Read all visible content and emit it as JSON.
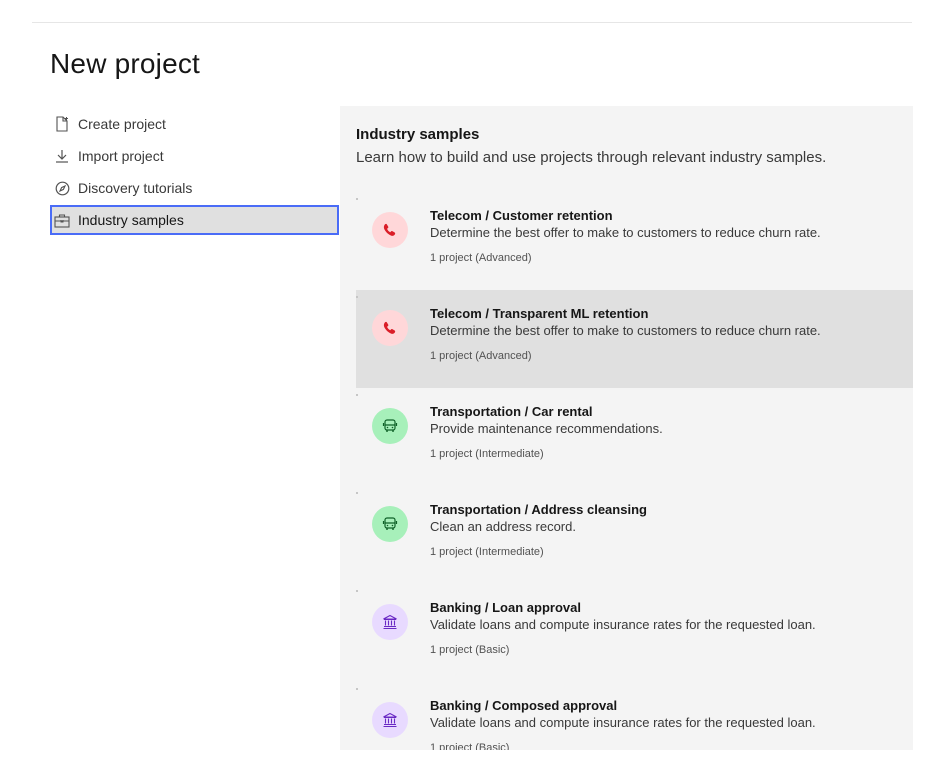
{
  "page": {
    "title": "New project"
  },
  "sidebar": {
    "items": [
      {
        "label": "Create project",
        "icon": "document-add-icon"
      },
      {
        "label": "Import project",
        "icon": "download-icon"
      },
      {
        "label": "Discovery tutorials",
        "icon": "compass-icon"
      },
      {
        "label": "Industry samples",
        "icon": "briefcase-icon",
        "selected": true
      }
    ]
  },
  "panel": {
    "title": "Industry samples",
    "description": "Learn how to build and use projects through relevant industry samples.",
    "cards": [
      {
        "title": "Telecom / Customer retention",
        "description": "Determine the best offer to make to customers to reduce churn rate.",
        "meta": "1 project (Advanced)",
        "icon": "phone-icon",
        "category": "telecom"
      },
      {
        "title": "Telecom / Transparent ML retention",
        "description": "Determine the best offer to make to customers to reduce churn rate.",
        "meta": "1 project (Advanced)",
        "icon": "phone-icon",
        "category": "telecom"
      },
      {
        "title": "Transportation / Car rental",
        "description": "Provide maintenance recommendations.",
        "meta": "1 project (Intermediate)",
        "icon": "bus-icon",
        "category": "transportation"
      },
      {
        "title": "Transportation / Address cleansing",
        "description": "Clean an address record.",
        "meta": "1 project (Intermediate)",
        "icon": "bus-icon",
        "category": "transportation"
      },
      {
        "title": "Banking / Loan approval",
        "description": "Validate loans and compute insurance rates for the requested loan.",
        "meta": "1 project (Basic)",
        "icon": "bank-icon",
        "category": "banking"
      },
      {
        "title": "Banking / Composed approval",
        "description": "Validate loans and compute insurance rates for the requested loan.",
        "meta": "1 project (Basic)",
        "icon": "bank-icon",
        "category": "banking"
      }
    ]
  },
  "colors": {
    "selection_outline": "#4a6cf7",
    "telecom_bg": "#ffd7d9",
    "telecom_fg": "#da1e28",
    "transport_bg": "#a7f0ba",
    "transport_fg": "#0e6027",
    "banking_bg": "#e8daff",
    "banking_fg": "#6929c4"
  }
}
